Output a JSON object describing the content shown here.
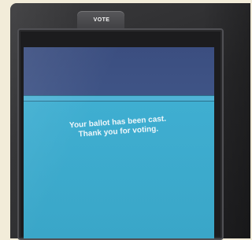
{
  "device": {
    "button_label": "VOTE"
  },
  "screen": {
    "message_line1": "Your ballot has been cast.",
    "message_line2": "Thank you for voting."
  },
  "colors": {
    "screen_top": "#3f5486",
    "screen_main": "#3ba9cb",
    "divider": "#4fb3d6",
    "bezel": "#2a2a2c",
    "background": "#f2ecd9"
  }
}
